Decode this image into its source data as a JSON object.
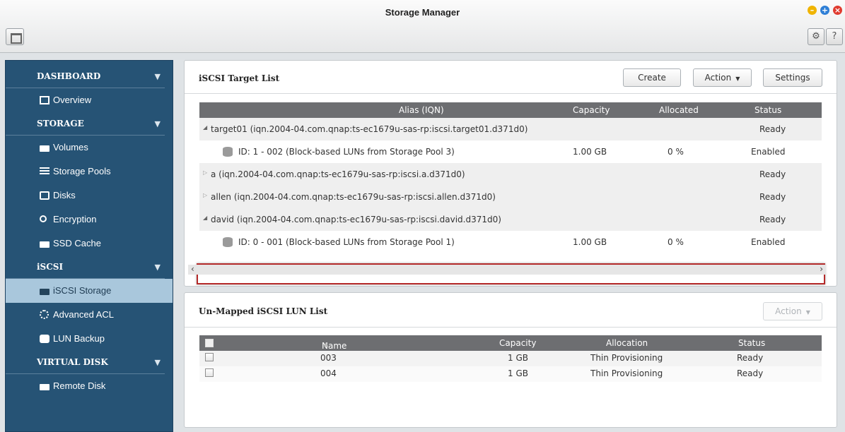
{
  "window": {
    "title": "Storage Manager"
  },
  "window_controls": [
    "minimize-icon",
    "maximize-icon",
    "close-icon"
  ],
  "toolbar": {
    "settings_icon": "gear-icon",
    "help_label": "?"
  },
  "sidebar": {
    "sections": [
      {
        "label": "DASHBOARD",
        "items": [
          {
            "label": "Overview",
            "icon": "document-icon"
          }
        ]
      },
      {
        "label": "STORAGE",
        "items": [
          {
            "label": "Volumes",
            "icon": "drive-icon"
          },
          {
            "label": "Storage Pools",
            "icon": "pool-icon"
          },
          {
            "label": "Disks",
            "icon": "disk-icon"
          },
          {
            "label": "Encryption",
            "icon": "key-icon"
          },
          {
            "label": "SSD Cache",
            "icon": "drive-icon"
          }
        ]
      },
      {
        "label": "iSCSI",
        "items": [
          {
            "label": "iSCSI Storage",
            "icon": "drive-icon",
            "active": true
          },
          {
            "label": "Advanced ACL",
            "icon": "gear-icon"
          },
          {
            "label": "LUN Backup",
            "icon": "backup-icon"
          }
        ]
      },
      {
        "label": "VIRTUAL DISK",
        "items": [
          {
            "label": "Remote Disk",
            "icon": "remote-disk-icon"
          }
        ]
      }
    ]
  },
  "target_panel": {
    "title": "iSCSI Target List",
    "buttons": {
      "create": "Create",
      "action": "Action",
      "settings": "Settings"
    },
    "columns": {
      "alias": "Alias (IQN)",
      "capacity": "Capacity",
      "allocated": "Allocated",
      "status": "Status"
    },
    "rows": [
      {
        "type": "target",
        "expanded": true,
        "alias": "target01 (iqn.2004-04.com.qnap:ts-ec1679u-sas-rp:iscsi.target01.d371d0)",
        "capacity": "",
        "allocated": "",
        "status": "Ready"
      },
      {
        "type": "lun",
        "alias": "ID: 1 - 002 (Block-based LUNs from Storage Pool 3)",
        "capacity": "1.00 GB",
        "allocated": "0 %",
        "status": "Enabled"
      },
      {
        "type": "target",
        "expanded": false,
        "alias": "a (iqn.2004-04.com.qnap:ts-ec1679u-sas-rp:iscsi.a.d371d0)",
        "capacity": "",
        "allocated": "",
        "status": "Ready"
      },
      {
        "type": "target",
        "expanded": false,
        "alias": "allen (iqn.2004-04.com.qnap:ts-ec1679u-sas-rp:iscsi.allen.d371d0)",
        "capacity": "",
        "allocated": "",
        "status": "Ready"
      },
      {
        "type": "target",
        "expanded": true,
        "alias": "david (iqn.2004-04.com.qnap:ts-ec1679u-sas-rp:iscsi.david.d371d0)",
        "capacity": "",
        "allocated": "",
        "status": "Ready"
      },
      {
        "type": "lun",
        "alias": "ID: 0 - 001 (Block-based LUNs from Storage Pool 1)",
        "capacity": "1.00 GB",
        "allocated": "0 %",
        "status": "Enabled",
        "highlighted": true
      }
    ]
  },
  "lun_panel": {
    "title": "Un-Mapped iSCSI LUN List",
    "action_label": "Action",
    "columns": {
      "name": "Name",
      "capacity": "Capacity",
      "allocation": "Allocation",
      "status": "Status"
    },
    "rows": [
      {
        "name": "003",
        "capacity": "1 GB",
        "allocation": "Thin Provisioning",
        "status": "Ready"
      },
      {
        "name": "004",
        "capacity": "1 GB",
        "allocation": "Thin Provisioning",
        "status": "Ready"
      }
    ]
  }
}
